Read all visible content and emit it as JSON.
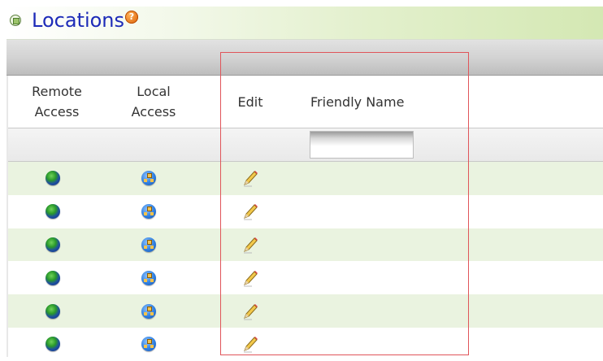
{
  "window": {
    "title": "Locations",
    "help_icon": "help-icon",
    "help_text": "?"
  },
  "table": {
    "columns": [
      {
        "key": "remote_access",
        "label_line1": "Remote",
        "label_line2": "Access"
      },
      {
        "key": "local_access",
        "label_line1": "Local",
        "label_line2": "Access"
      },
      {
        "key": "edit",
        "label": "Edit"
      },
      {
        "key": "friendly_name",
        "label": "Friendly Name"
      }
    ],
    "filter": {
      "friendly_name_value": "",
      "friendly_name_placeholder": ""
    },
    "rows": [
      {
        "remote_icon": "globe-icon",
        "local_icon": "network-icon",
        "edit_icon": "pencil-icon",
        "friendly_name": ""
      },
      {
        "remote_icon": "globe-icon",
        "local_icon": "network-icon",
        "edit_icon": "pencil-icon",
        "friendly_name": ""
      },
      {
        "remote_icon": "globe-icon",
        "local_icon": "network-icon",
        "edit_icon": "pencil-icon",
        "friendly_name": ""
      },
      {
        "remote_icon": "globe-icon",
        "local_icon": "network-icon",
        "edit_icon": "pencil-icon",
        "friendly_name": ""
      },
      {
        "remote_icon": "globe-icon",
        "local_icon": "network-icon",
        "edit_icon": "pencil-icon",
        "friendly_name": ""
      },
      {
        "remote_icon": "globe-icon",
        "local_icon": "network-icon",
        "edit_icon": "pencil-icon",
        "friendly_name": ""
      }
    ]
  },
  "colors": {
    "title": "#1d2bb8",
    "row_alt": "#eaf3e0",
    "highlight": "#e0555a"
  }
}
